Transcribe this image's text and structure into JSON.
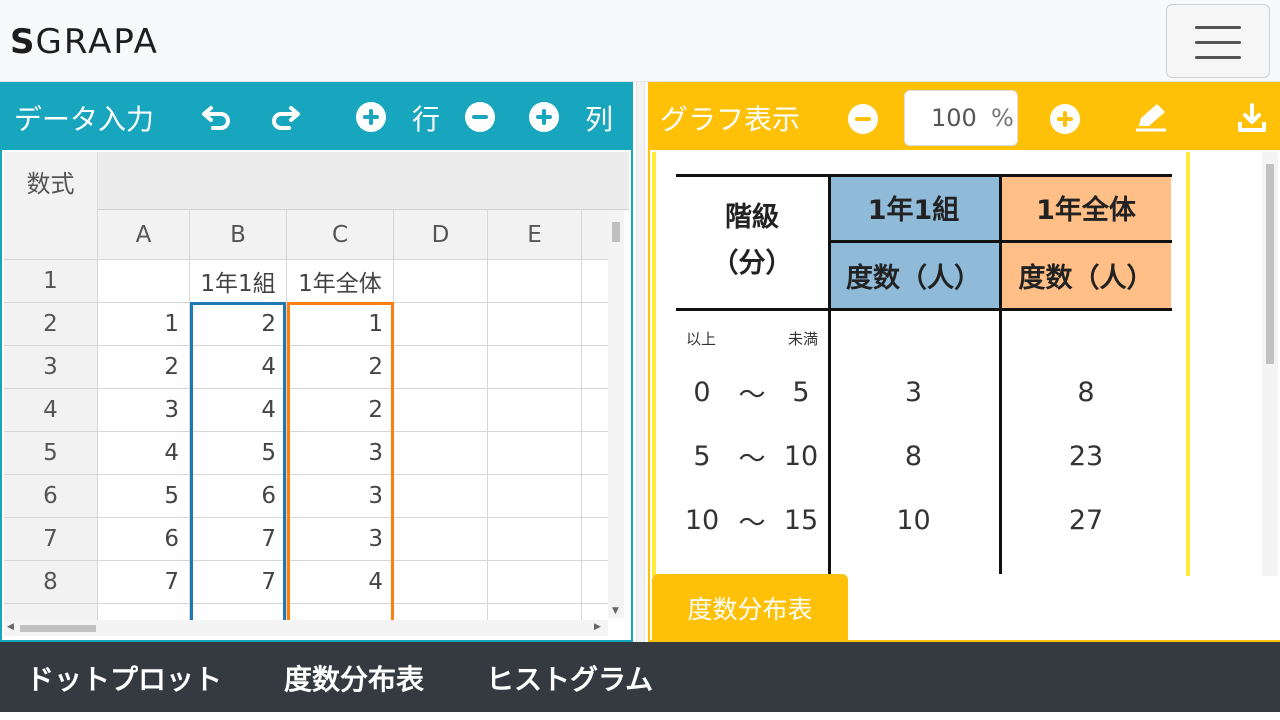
{
  "header": {
    "logo_mark": "S",
    "logo_text": "GRAPA"
  },
  "left_panel": {
    "title": "データ入力",
    "row_label": "行",
    "col_label": "列",
    "formula_label": "数式"
  },
  "right_panel": {
    "title": "グラフ表示",
    "zoom_value": "100",
    "zoom_unit": "%",
    "sheet_tab": "度数分布表"
  },
  "spreadsheet": {
    "columns": [
      "A",
      "B",
      "C",
      "D",
      "E"
    ],
    "rows": [
      {
        "n": "1",
        "a": "",
        "b": "1年1組",
        "c": "1年全体"
      },
      {
        "n": "2",
        "a": "1",
        "b": "2",
        "c": "1"
      },
      {
        "n": "3",
        "a": "2",
        "b": "4",
        "c": "2"
      },
      {
        "n": "4",
        "a": "3",
        "b": "4",
        "c": "2"
      },
      {
        "n": "5",
        "a": "4",
        "b": "5",
        "c": "3"
      },
      {
        "n": "6",
        "a": "5",
        "b": "6",
        "c": "3"
      },
      {
        "n": "7",
        "a": "6",
        "b": "7",
        "c": "3"
      },
      {
        "n": "8",
        "a": "7",
        "b": "7",
        "c": "4"
      }
    ],
    "colors": {
      "col_b": "#1f77b4",
      "col_c": "#ff7f0e"
    }
  },
  "frequency_table": {
    "class_header_line1": "階級",
    "class_header_line2": "（分）",
    "group1": "1年1組",
    "group2": "1年全体",
    "count_label1": "度数（人）",
    "count_label2": "度数（人）",
    "lower_label": "以上",
    "upper_label": "未満",
    "tilde": "〜",
    "group1_color": "#8fbbd9",
    "group2_color": "#ffbf86",
    "rows": [
      {
        "from": "0",
        "to": "5",
        "g1": "3",
        "g2": "8"
      },
      {
        "from": "5",
        "to": "10",
        "g1": "8",
        "g2": "23"
      },
      {
        "from": "10",
        "to": "15",
        "g1": "10",
        "g2": "27"
      }
    ]
  },
  "bottom_nav": {
    "items": [
      "ドットプロット",
      "度数分布表",
      "ヒストグラム"
    ]
  }
}
